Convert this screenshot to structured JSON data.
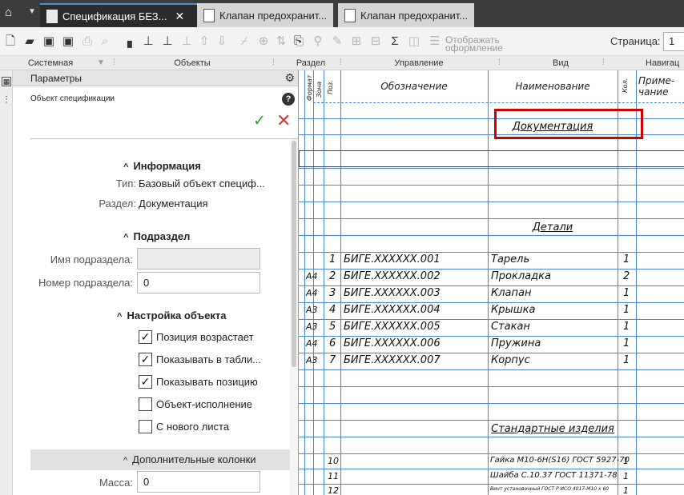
{
  "tabs": [
    {
      "label": "Спецификация БЕЗ...",
      "active": true
    },
    {
      "label": "Клапан предохранит...",
      "active": false
    },
    {
      "label": "Клапан предохранит...",
      "active": false
    }
  ],
  "toolbar": {
    "display_label": "Отображать оформление",
    "page_label": "Страница:",
    "page_value": "1"
  },
  "groups": {
    "system": "Системная",
    "objects": "Объекты",
    "section": "Раздел",
    "control": "Управление",
    "view": "Вид",
    "nav": "Навигац"
  },
  "panel": {
    "title": "Параметры",
    "object_label": "Объект спецификации",
    "info": {
      "header": "Информация",
      "type_label": "Тип:",
      "type_value": "Базовый объект специф...",
      "section_label": "Раздел:",
      "section_value": "Документация"
    },
    "subsection": {
      "header": "Подраздел",
      "name_label": "Имя подраздела:",
      "name_value": "",
      "number_label": "Номер подраздела:",
      "number_value": "0"
    },
    "settings": {
      "header": "Настройка объекта",
      "checkboxes": [
        {
          "label": "Позиция возрастает",
          "checked": true
        },
        {
          "label": "Показывать в табли...",
          "checked": true
        },
        {
          "label": "Показывать позицию",
          "checked": true
        },
        {
          "label": "Объект-исполнение",
          "checked": false
        },
        {
          "label": "С нового листа",
          "checked": false
        }
      ]
    },
    "extra": {
      "header": "Дополнительные колонки",
      "mass_label": "Масса:",
      "mass_value": "0"
    }
  },
  "spec": {
    "headers": {
      "format": "Формат",
      "zone": "Зона",
      "pos": "Поз.",
      "designation": "Обозначение",
      "name": "Наименование",
      "qty": "Кол.",
      "note1": "Приме-",
      "note2": "чание"
    },
    "section_documentation": "Документация",
    "section_details": "Детали",
    "section_standard": "Стандартные изделия",
    "rows": [
      {
        "format": "",
        "pos": "1",
        "designation": "БИГЕ.XXXXXX.001",
        "name": "Тарель",
        "qty": "1"
      },
      {
        "format": "А4",
        "pos": "2",
        "designation": "БИГЕ.XXXXXX.002",
        "name": "Прокладка",
        "qty": "2"
      },
      {
        "format": "А4",
        "pos": "3",
        "designation": "БИГЕ.XXXXXX.003",
        "name": "Клапан",
        "qty": "1"
      },
      {
        "format": "А3",
        "pos": "4",
        "designation": "БИГЕ.XXXXXX.004",
        "name": "Крышка",
        "qty": "1"
      },
      {
        "format": "А3",
        "pos": "5",
        "designation": "БИГЕ.XXXXXX.005",
        "name": "Стакан",
        "qty": "1"
      },
      {
        "format": "А4",
        "pos": "6",
        "designation": "БИГЕ.XXXXXX.006",
        "name": "Пружина",
        "qty": "1"
      },
      {
        "format": "А3",
        "pos": "7",
        "designation": "БИГЕ.XXXXXX.007",
        "name": "Корпус",
        "qty": "1"
      }
    ],
    "std_rows": [
      {
        "pos": "10",
        "name": "Гайка М10-6Н(S16) ГОСТ 5927-70",
        "qty": "1"
      },
      {
        "pos": "11",
        "name": "Шайба С.10.37 ГОСТ 11371-78",
        "qty": "1"
      },
      {
        "pos": "12",
        "name": "Винт установочный ГОСТ Р ИСО 4017-М10 х 60",
        "qty": "1"
      }
    ]
  }
}
